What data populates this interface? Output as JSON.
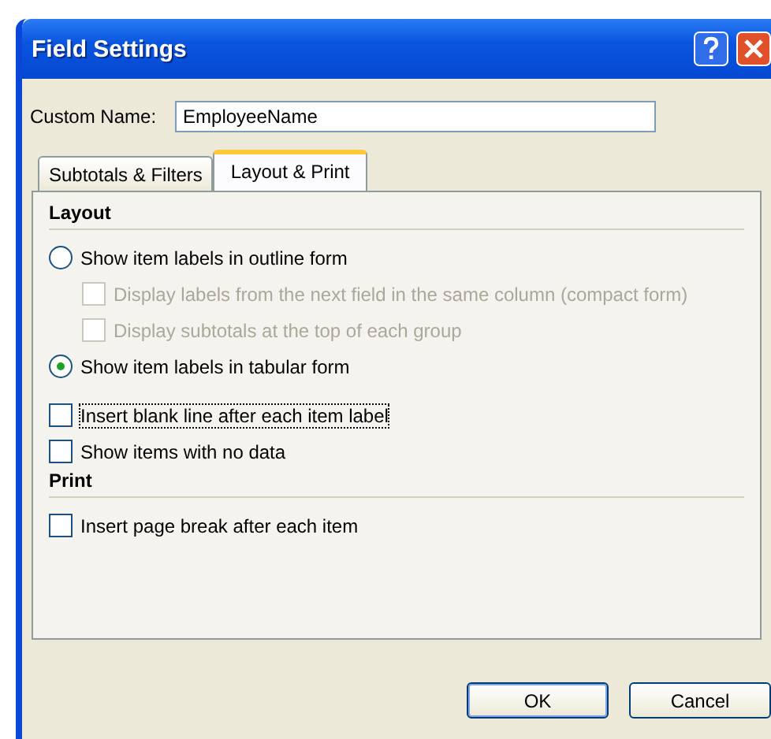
{
  "window": {
    "title": "Field Settings"
  },
  "custom_name": {
    "label": "Custom Name:",
    "value": "EmployeeName"
  },
  "tabs": [
    {
      "label": "Subtotals & Filters",
      "selected": false
    },
    {
      "label": "Layout & Print",
      "selected": true
    }
  ],
  "sections": [
    {
      "heading": "Layout",
      "options": [
        {
          "kind": "radio",
          "label": "Show item labels in outline form",
          "selected": false,
          "children": [
            {
              "kind": "checkbox",
              "label": "Display labels from the next field in the same column (compact form)",
              "checked": false,
              "disabled": true
            },
            {
              "kind": "checkbox",
              "label": "Display subtotals at the top of each group",
              "checked": false,
              "disabled": true
            }
          ]
        },
        {
          "kind": "radio",
          "label": "Show item labels in tabular form",
          "selected": true
        },
        {
          "kind": "checkbox",
          "label": "Insert blank line after each item label",
          "checked": false,
          "focused": true
        },
        {
          "kind": "checkbox",
          "label": "Show items with no data",
          "checked": false
        }
      ]
    },
    {
      "heading": "Print",
      "options": [
        {
          "kind": "checkbox",
          "label": "Insert page break after each item",
          "checked": false
        }
      ]
    }
  ],
  "buttons": [
    "OK",
    "Cancel"
  ]
}
